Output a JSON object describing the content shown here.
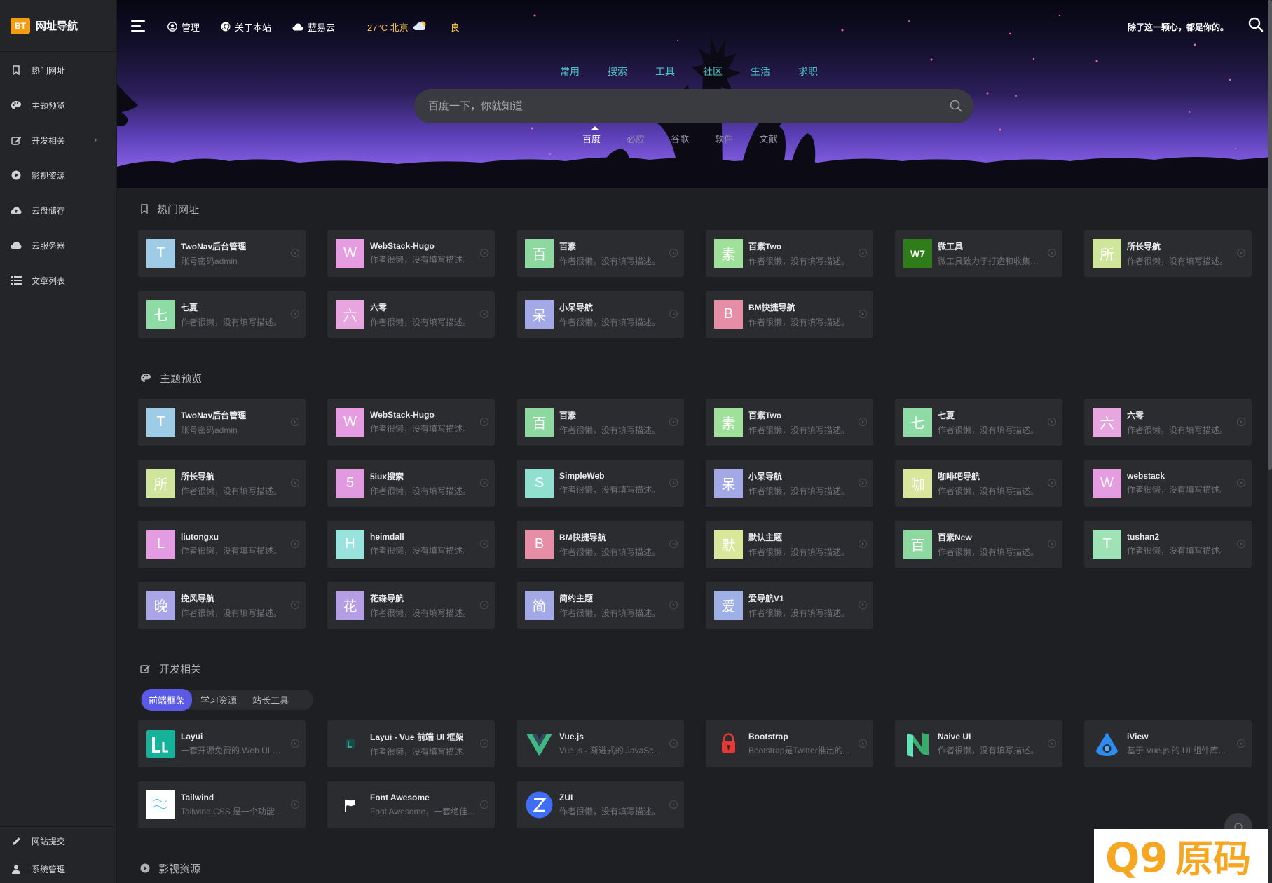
{
  "brand": {
    "logo": "BT",
    "name": "网址导航",
    "accent": "#f39c12"
  },
  "sidebar": {
    "items": [
      {
        "label": "热门网址",
        "icon": "bookmark-icon"
      },
      {
        "label": "主题预览",
        "icon": "palette-icon"
      },
      {
        "label": "开发相关",
        "icon": "edit-icon",
        "has_children": true
      },
      {
        "label": "影视资源",
        "icon": "play-icon"
      },
      {
        "label": "云盘储存",
        "icon": "cloud-upload-icon"
      },
      {
        "label": "云服务器",
        "icon": "cloud-icon"
      },
      {
        "label": "文章列表",
        "icon": "list-icon"
      }
    ],
    "bottom": [
      {
        "label": "网站提交",
        "icon": "pencil-icon"
      },
      {
        "label": "系统管理",
        "icon": "user-icon"
      }
    ]
  },
  "topbar": {
    "links": [
      {
        "label": "管理",
        "icon": "user-circle-icon"
      },
      {
        "label": "关于本站",
        "icon": "github-icon"
      },
      {
        "label": "蓝易云",
        "icon": "cloud-icon"
      }
    ],
    "weather": "27°C 北京",
    "air_quality": "良",
    "slogan": "除了这一颗心，都是你的。"
  },
  "search": {
    "categories": [
      "常用",
      "搜索",
      "工具",
      "社区",
      "生活",
      "求职"
    ],
    "placeholder": "百度一下，你就知道",
    "engines": [
      "百度",
      "必应",
      "谷歌",
      "软件",
      "文献"
    ],
    "active_engine": "百度"
  },
  "sections": {
    "hot": {
      "title": "热门网址",
      "cards": [
        {
          "initial": "T",
          "color": "#9ecbe6",
          "name": "TwoNav后台管理",
          "desc": "账号密码admin"
        },
        {
          "initial": "W",
          "color": "#e59ce0",
          "name": "WebStack-Hugo",
          "desc": "作者很懒，没有填写描述。"
        },
        {
          "initial": "百",
          "color": "#8cd89e",
          "name": "百素",
          "desc": "作者很懒，没有填写描述。"
        },
        {
          "initial": "素",
          "color": "#9fe09a",
          "name": "百素Two",
          "desc": "作者很懒，没有填写描述。"
        },
        {
          "initial": "W7",
          "color": "#2e7d1a",
          "name": "微工具",
          "desc": "微工具致力于打造和收集各..."
        },
        {
          "initial": "所",
          "color": "#cfe59b",
          "name": "所长导航",
          "desc": "作者很懒，没有填写描述。"
        },
        {
          "initial": "七",
          "color": "#8edba6",
          "name": "七夏",
          "desc": "作者很懒，没有填写描述。"
        },
        {
          "initial": "六",
          "color": "#e7a6e0",
          "name": "六零",
          "desc": "作者很懒，没有填写描述。"
        },
        {
          "initial": "呆",
          "color": "#a3a8e6",
          "name": "小呆导航",
          "desc": "作者很懒，没有填写描述。"
        },
        {
          "initial": "B",
          "color": "#e58ea5",
          "name": "BM快捷导航",
          "desc": "作者很懒，没有填写描述。"
        }
      ]
    },
    "themes": {
      "title": "主题预览",
      "cards": [
        {
          "initial": "T",
          "color": "#9ecbe6",
          "name": "TwoNav后台管理",
          "desc": "账号密码admin"
        },
        {
          "initial": "W",
          "color": "#e59ce0",
          "name": "WebStack-Hugo",
          "desc": "作者很懒，没有填写描述。"
        },
        {
          "initial": "百",
          "color": "#8cd89e",
          "name": "百素",
          "desc": "作者很懒，没有填写描述。"
        },
        {
          "initial": "素",
          "color": "#9fe09a",
          "name": "百素Two",
          "desc": "作者很懒，没有填写描述。"
        },
        {
          "initial": "七",
          "color": "#8edba6",
          "name": "七夏",
          "desc": "作者很懒，没有填写描述。"
        },
        {
          "initial": "六",
          "color": "#e7a6e0",
          "name": "六零",
          "desc": "作者很懒，没有填写描述。"
        },
        {
          "initial": "所",
          "color": "#cfe59b",
          "name": "所长导航",
          "desc": "作者很懒，没有填写描述。"
        },
        {
          "initial": "5",
          "color": "#e19ae0",
          "name": "5iux搜索",
          "desc": "作者很懒，没有填写描述。"
        },
        {
          "initial": "S",
          "color": "#8fe0cf",
          "name": "SimpleWeb",
          "desc": "作者很懒，没有填写描述。"
        },
        {
          "initial": "呆",
          "color": "#a3a8e6",
          "name": "小呆导航",
          "desc": "作者很懒，没有填写描述。"
        },
        {
          "initial": "咖",
          "color": "#d9e69b",
          "name": "咖啡吧导航",
          "desc": "作者很懒，没有填写描述。"
        },
        {
          "initial": "W",
          "color": "#e59ce0",
          "name": "webstack",
          "desc": "作者很懒，没有填写描述。"
        },
        {
          "initial": "L",
          "color": "#e39be2",
          "name": "liutongxu",
          "desc": "作者很懒，没有填写描述。"
        },
        {
          "initial": "H",
          "color": "#9ae2de",
          "name": "heimdall",
          "desc": "作者很懒，没有填写描述。"
        },
        {
          "initial": "B",
          "color": "#e58ea5",
          "name": "BM快捷导航",
          "desc": "作者很懒，没有填写描述。"
        },
        {
          "initial": "默",
          "color": "#d8e79a",
          "name": "默认主题",
          "desc": "作者很懒，没有填写描述。"
        },
        {
          "initial": "百",
          "color": "#8cd89e",
          "name": "百素New",
          "desc": "作者很懒，没有填写描述。"
        },
        {
          "initial": "T",
          "color": "#9fe2b6",
          "name": "tushan2",
          "desc": "作者很懒，没有填写描述。"
        },
        {
          "initial": "晚",
          "color": "#a9a5e6",
          "name": "挽风导航",
          "desc": "作者很懒，没有填写描述。"
        },
        {
          "initial": "花",
          "color": "#b59ee4",
          "name": "花森导航",
          "desc": "作者很懒，没有填写描述。"
        },
        {
          "initial": "简",
          "color": "#a3a8e6",
          "name": "简约主题",
          "desc": "作者很懒，没有填写描述。"
        },
        {
          "initial": "爱",
          "color": "#9fb0e6",
          "name": "爱导航V1",
          "desc": "作者很懒，没有填写描述。"
        }
      ]
    },
    "dev": {
      "title": "开发相关",
      "subtabs": [
        "前端框架",
        "学习资源",
        "站长工具"
      ],
      "active_subtab": "前端框架",
      "cards": [
        {
          "logo": "layui-logo",
          "name": "Layui",
          "desc": "一套开源免费的 Web UI 组..."
        },
        {
          "logo": "layui-vue-logo",
          "name": "Layui - Vue 前端 UI 框架",
          "desc": "作者很懒，没有填写描述。"
        },
        {
          "logo": "vue-logo",
          "name": "Vue.js",
          "desc": "Vue.js - 渐进式的 JavaScri..."
        },
        {
          "logo": "bootstrap-logo",
          "name": "Bootstrap",
          "desc": "Bootstrap是Twitter推出的..."
        },
        {
          "logo": "naive-ui-logo",
          "name": "Naive UI",
          "desc": "作者很懒，没有填写描述。"
        },
        {
          "logo": "iview-logo",
          "name": "iView",
          "desc": "基于 Vue.js 的 UI 组件库。..."
        },
        {
          "logo": "tailwind-logo",
          "name": "Tailwind",
          "desc": "Tailwind CSS 是一个功能类..."
        },
        {
          "logo": "font-awesome-logo",
          "name": "Font Awesome",
          "desc": "Font Awesome，一套绝佳..."
        },
        {
          "logo": "zui-logo",
          "name": "ZUI",
          "desc": "作者很懒，没有填写描述。"
        }
      ]
    },
    "video": {
      "title": "影视资源"
    }
  },
  "watermark": "Q9原码"
}
